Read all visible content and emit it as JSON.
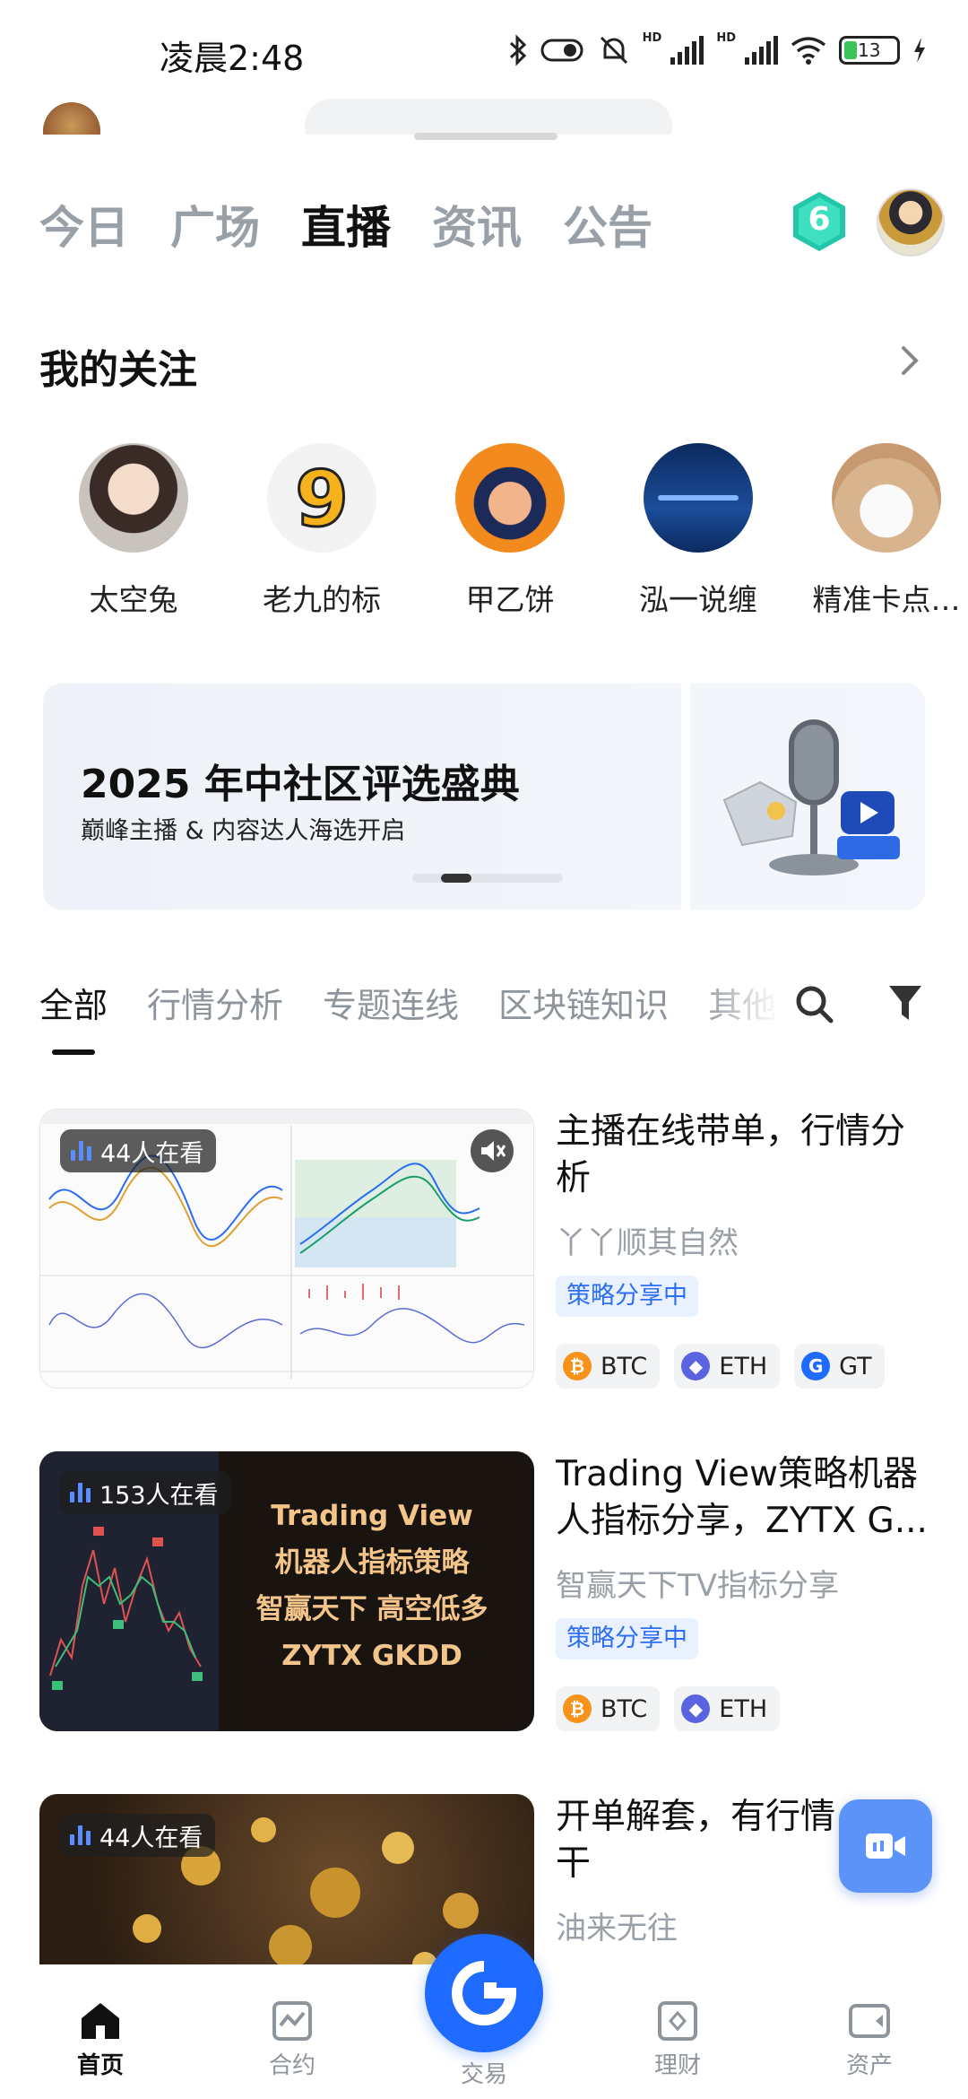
{
  "status_bar": {
    "time": "凌晨2:48",
    "battery": "13"
  },
  "top_tabs": [
    {
      "label": "今日",
      "active": false
    },
    {
      "label": "广场",
      "active": false
    },
    {
      "label": "直播",
      "active": true
    },
    {
      "label": "资讯",
      "active": false
    },
    {
      "label": "公告",
      "active": false
    }
  ],
  "level_badge": "6",
  "following": {
    "title": "我的关注",
    "users": [
      {
        "name": "太空兔"
      },
      {
        "name": "老九的标"
      },
      {
        "name": "甲乙饼"
      },
      {
        "name": "泓一说缠"
      },
      {
        "name": "精准卡点…"
      }
    ]
  },
  "banner": {
    "title": "2025 年中社区评选盛典",
    "subtitle": "巅峰主播 & 内容达人海选开启"
  },
  "category_tabs": [
    {
      "label": "全部",
      "active": true
    },
    {
      "label": "行情分析",
      "active": false
    },
    {
      "label": "专题连线",
      "active": false
    },
    {
      "label": "区块链知识",
      "active": false
    },
    {
      "label": "其他",
      "active": false
    }
  ],
  "streams": [
    {
      "viewers": "44人在看",
      "title": "主播在线带单，行情分析",
      "author": "丫丫顺其自然",
      "tag": "策略分享中",
      "coins": [
        "BTC",
        "ETH",
        "GT"
      ]
    },
    {
      "viewers": "153人在看",
      "title": "Trading View策略机器人指标分享，ZYTX G...",
      "author": "智赢天下TV指标分享",
      "tag": "策略分享中",
      "coins": [
        "BTC",
        "ETH"
      ],
      "thumb_lines": [
        "Trading View",
        "机器人指标策略",
        "智赢天下 高空低多",
        "ZYTX GKDD"
      ]
    },
    {
      "viewers": "44人在看",
      "title": "开单解套，有行情干",
      "author": "油来无往",
      "tag": "",
      "coins": []
    }
  ],
  "bottom_nav": {
    "home": "首页",
    "futures": "合约",
    "trade": "交易",
    "earn": "理财",
    "assets": "资产"
  },
  "colors": {
    "brand_blue": "#1f6bff",
    "tag_blue": "#2d6ef5",
    "float_button": "#5b93f8",
    "level_badge": "#21c7a8"
  }
}
